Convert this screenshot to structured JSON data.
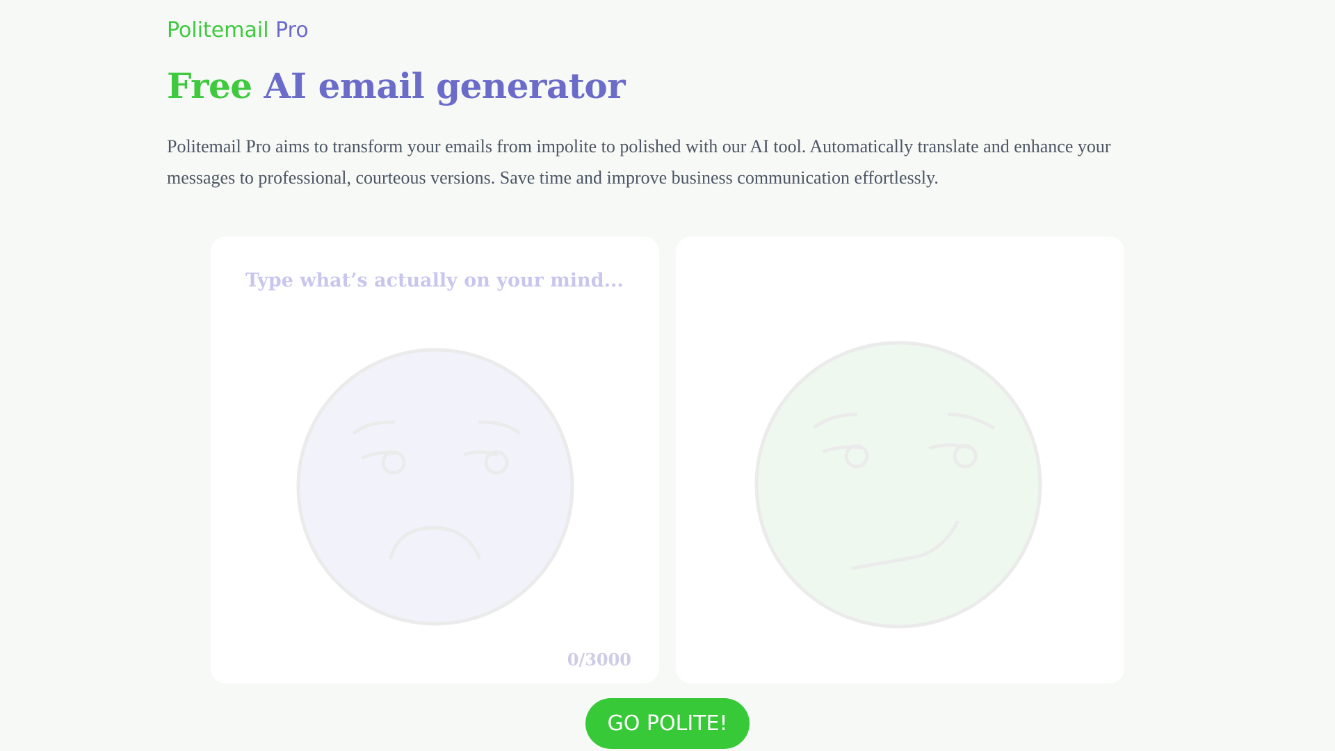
{
  "logo": {
    "part1": "Politemail",
    "part2": "Pro"
  },
  "headline": {
    "part1": "Free",
    "part2": "AI email generator"
  },
  "intro": "Politemail Pro aims to transform your emails from impolite to polished with our AI tool. Automatically translate and enhance your messages to professional, courteous versions. Save time and improve business communication effortlessly.",
  "input_panel": {
    "placeholder": "Type what’s actually on your mind...",
    "value": "",
    "counter": "0/3000",
    "face_icon": "sad-face-icon"
  },
  "output_panel": {
    "value": "",
    "face_icon": "smirk-face-icon"
  },
  "action": {
    "label": "GO POLITE!"
  },
  "colors": {
    "brand_green": "#3ec93e",
    "brand_purple": "#6b6bc9",
    "button_green": "#38c938",
    "page_bg": "#f6f9f6"
  }
}
